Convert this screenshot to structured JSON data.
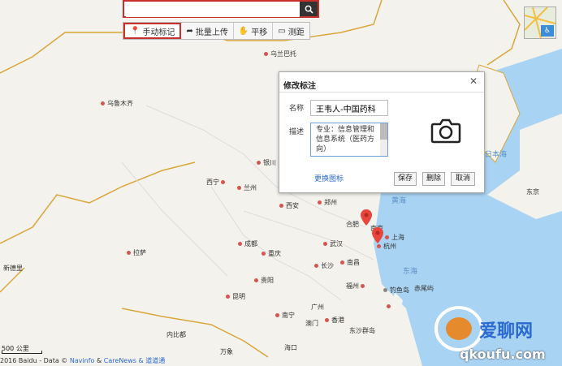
{
  "search": {
    "placeholder": ""
  },
  "toolbar": [
    {
      "icon": "pin-icon",
      "label": "手动标记"
    },
    {
      "icon": "arrow-icon",
      "label": "批量上传"
    },
    {
      "icon": "hand-icon",
      "label": "平移"
    },
    {
      "icon": "ruler-icon",
      "label": "测距"
    }
  ],
  "dialog": {
    "title": "修改标注",
    "name_label": "名称",
    "name_value": "王韦人-中国药科",
    "desc_label": "描述",
    "desc_value": "专业：信息管理和信息系统（医药方向）",
    "change_icon": "更换图标",
    "save": "保存",
    "delete": "删除",
    "cancel": "取消"
  },
  "map": {
    "cities": [
      "乌兰巴托",
      "乌鲁木齐",
      "银川",
      "西宁",
      "兰州",
      "西安",
      "郑州",
      "合肥",
      "南京",
      "上海",
      "杭州",
      "成都",
      "武汉",
      "重庆",
      "拉萨",
      "长沙",
      "南昌",
      "福州",
      "新德里",
      "贵阳",
      "昆明",
      "南宁",
      "广州",
      "澳门",
      "香港",
      "台北",
      "内比都",
      "万象",
      "海口",
      "东京"
    ],
    "seas": [
      "日本海",
      "黄海",
      "东海",
      "钓鱼岛",
      "赤尾屿",
      "东沙群岛"
    ]
  },
  "footer": {
    "scale": "500 公里",
    "copyright_prefix": "2016 Baidu - Data ©",
    "copyright_links": [
      "Navinfo",
      "&",
      "CareNews",
      "& 道道通"
    ]
  },
  "watermark": {
    "text": "爱聊网",
    "url": "qkoufu.com"
  },
  "colors": {
    "accent": "#c9302c",
    "link": "#2a6ad1",
    "pin": "#e8453c",
    "sea": "#a9d3f2"
  }
}
